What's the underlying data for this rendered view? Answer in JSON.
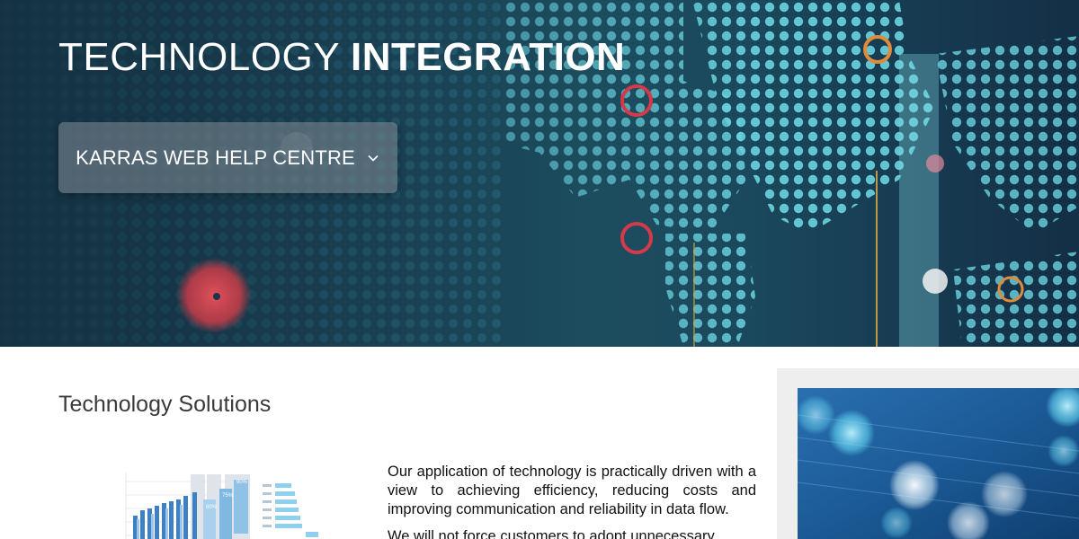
{
  "hero": {
    "title_light": "TECHNOLOGY",
    "title_bold": "INTEGRATION",
    "help_button_label": "KARRAS WEB HELP CENTRE",
    "help_button_icon": "chevron-down-icon"
  },
  "main": {
    "section_title": "Technology Solutions",
    "paragraphs": [
      "Our application of technology is practically driven with a view to achieving efficiency, reducing costs and improving communication and reliability in data flow.",
      "We will not force customers to adopt unnecessary"
    ],
    "illustration_labels": [
      "60%",
      "75%",
      "90%"
    ]
  },
  "colors": {
    "hero_dot": "#6ad4e0",
    "accent_red": "#d43a4a",
    "accent_orange": "#e08a3a",
    "sidebar_bg": "#eeeeee",
    "text": "#111111",
    "heading": "#3a3a3a"
  }
}
